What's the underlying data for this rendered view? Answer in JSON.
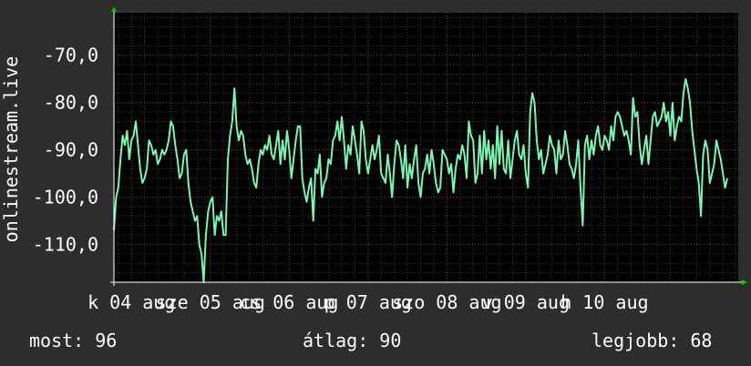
{
  "chart_data": {
    "type": "line",
    "ylabel": "onlinestream.live",
    "ylim": [
      -118,
      -61
    ],
    "yticks": [
      {
        "v": -70,
        "label": "-70,0"
      },
      {
        "v": -80,
        "label": "-80,0"
      },
      {
        "v": -90,
        "label": "-90,0"
      },
      {
        "v": -100,
        "label": "-100,0"
      },
      {
        "v": -110,
        "label": "-110,0"
      }
    ],
    "xlim": [
      0,
      285
    ],
    "xticks": [
      {
        "v": 8,
        "label": "k 04 aug"
      },
      {
        "v": 44,
        "label": "sze 05 aug"
      },
      {
        "v": 80,
        "label": "cs 06 aug"
      },
      {
        "v": 116,
        "label": "p 07 aug"
      },
      {
        "v": 152,
        "label": "szo 08 aug"
      },
      {
        "v": 188,
        "label": "v 09 aug"
      },
      {
        "v": 224,
        "label": "h 10 aug"
      }
    ],
    "grid": true,
    "line_color": "#7cf5b4",
    "series": [
      {
        "values": [
          -107,
          -100,
          -98,
          -92,
          -87,
          -89,
          -86,
          -92,
          -88,
          -87,
          -84,
          -89,
          -94,
          -97,
          -96,
          -94,
          -88,
          -89,
          -91,
          -90,
          -93,
          -92,
          -90,
          -91,
          -90,
          -88,
          -84,
          -85,
          -89,
          -92,
          -96,
          -95,
          -91,
          -90,
          -97,
          -101,
          -103,
          -105,
          -104,
          -110,
          -112,
          -118,
          -108,
          -103,
          -101,
          -100,
          -108,
          -104,
          -105,
          -103,
          -108,
          -108,
          -92,
          -87,
          -84,
          -77,
          -85,
          -88,
          -86,
          -87,
          -91,
          -93,
          -92,
          -94,
          -97,
          -98,
          -93,
          -90,
          -91,
          -89,
          -90,
          -87,
          -91,
          -92,
          -89,
          -86,
          -93,
          -88,
          -92,
          -86,
          -90,
          -96,
          -92,
          -88,
          -85,
          -85,
          -96,
          -99,
          -101,
          -98,
          -96,
          -105,
          -94,
          -95,
          -91,
          -100,
          -97,
          -96,
          -92,
          -93,
          -88,
          -87,
          -84,
          -88,
          -83,
          -88,
          -94,
          -89,
          -91,
          -85,
          -88,
          -91,
          -95,
          -84,
          -86,
          -92,
          -95,
          -92,
          -89,
          -92,
          -90,
          -87,
          -95,
          -96,
          -97,
          -91,
          -95,
          -100,
          -93,
          -88,
          -89,
          -92,
          -96,
          -89,
          -98,
          -93,
          -96,
          -92,
          -89,
          -97,
          -100,
          -95,
          -94,
          -91,
          -95,
          -90,
          -93,
          -97,
          -99,
          -98,
          -90,
          -91,
          -92,
          -95,
          -93,
          -99,
          -94,
          -91,
          -92,
          -89,
          -91,
          -96,
          -84,
          -87,
          -88,
          -97,
          -95,
          -87,
          -95,
          -86,
          -92,
          -88,
          -94,
          -89,
          -96,
          -85,
          -93,
          -86,
          -94,
          -95,
          -88,
          -96,
          -92,
          -88,
          -86,
          -91,
          -92,
          -89,
          -95,
          -98,
          -82,
          -78,
          -80,
          -88,
          -92,
          -90,
          -95,
          -93,
          -91,
          -87,
          -89,
          -90,
          -95,
          -88,
          -92,
          -91,
          -86,
          -89,
          -93,
          -94,
          -96,
          -93,
          -88,
          -98,
          -106,
          -89,
          -87,
          -92,
          -88,
          -91,
          -87,
          -85,
          -89,
          -90,
          -87,
          -88,
          -90,
          -85,
          -88,
          -83,
          -82,
          -83,
          -85,
          -87,
          -86,
          -88,
          -91,
          -79,
          -83,
          -82,
          -89,
          -93,
          -90,
          -87,
          -93,
          -88,
          -83,
          -82,
          -85,
          -84,
          -83,
          -80,
          -84,
          -82,
          -87,
          -80,
          -88,
          -85,
          -83,
          -84,
          -78,
          -75,
          -77,
          -80,
          -86,
          -90,
          -94,
          -97,
          -104,
          -91,
          -88,
          -90,
          -97,
          -95,
          -93,
          -88,
          -90,
          -92,
          -95,
          -98,
          -96
        ]
      }
    ],
    "footer": {
      "now": "most: 96",
      "avg": "átlag: 90",
      "best": "legjobb: 68"
    }
  }
}
